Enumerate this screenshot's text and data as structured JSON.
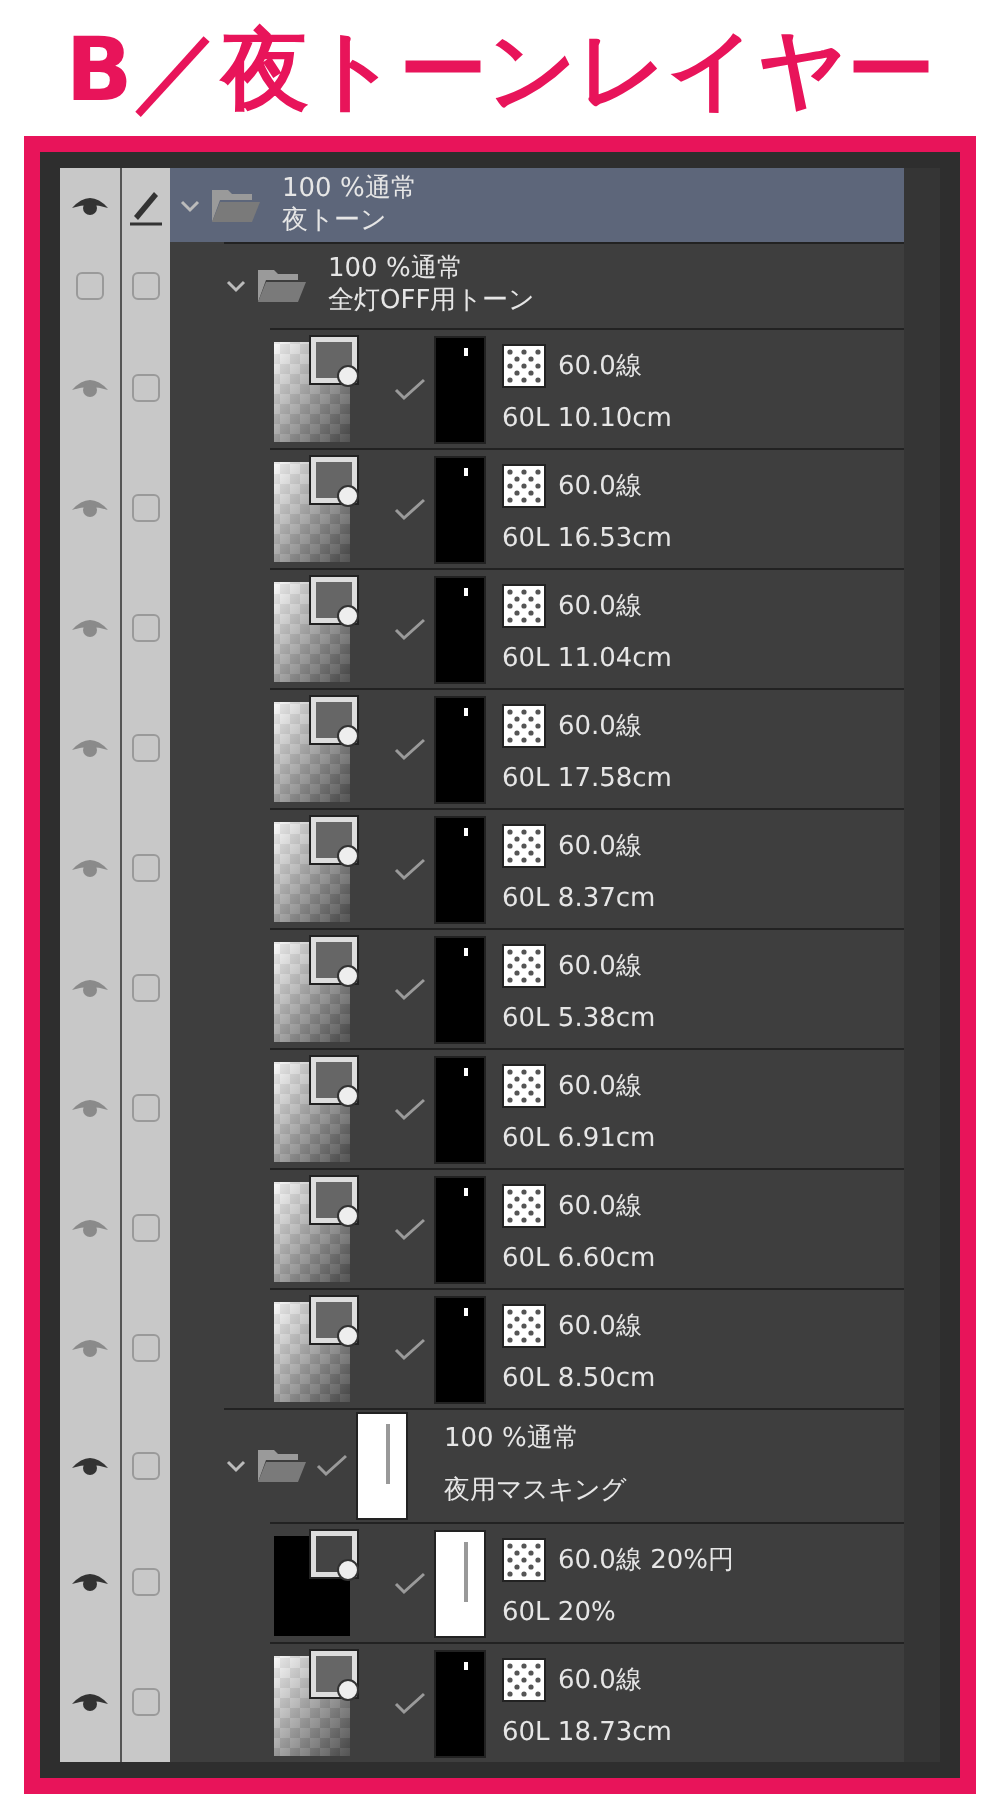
{
  "title": "B／夜トーンレイヤー",
  "layers": [
    {
      "kind": "folder",
      "selected": true,
      "visible": true,
      "editing": true,
      "expanded": true,
      "blend": "100 %通常",
      "name": "夜トーン",
      "children": [
        {
          "kind": "folder",
          "selected": false,
          "visible": false,
          "editing": false,
          "expanded": true,
          "blend": "100 %通常",
          "name": "全灯OFF用トーン",
          "children": [
            {
              "kind": "tone",
              "selected": false,
              "visible": true,
              "editing": false,
              "screen": "60.0線",
              "info": "60L 10.10cm",
              "base_black": false,
              "mask_white": false
            },
            {
              "kind": "tone",
              "selected": false,
              "visible": true,
              "editing": false,
              "screen": "60.0線",
              "info": "60L 16.53cm",
              "base_black": false,
              "mask_white": false
            },
            {
              "kind": "tone",
              "selected": false,
              "visible": true,
              "editing": false,
              "screen": "60.0線",
              "info": "60L 11.04cm",
              "base_black": false,
              "mask_white": false
            },
            {
              "kind": "tone",
              "selected": false,
              "visible": true,
              "editing": false,
              "screen": "60.0線",
              "info": "60L 17.58cm",
              "base_black": false,
              "mask_white": false
            },
            {
              "kind": "tone",
              "selected": false,
              "visible": true,
              "editing": false,
              "screen": "60.0線",
              "info": "60L 8.37cm",
              "base_black": false,
              "mask_white": false
            },
            {
              "kind": "tone",
              "selected": false,
              "visible": true,
              "editing": false,
              "screen": "60.0線",
              "info": "60L 5.38cm",
              "base_black": false,
              "mask_white": false
            },
            {
              "kind": "tone",
              "selected": false,
              "visible": true,
              "editing": false,
              "screen": "60.0線",
              "info": "60L 6.91cm",
              "base_black": false,
              "mask_white": false
            },
            {
              "kind": "tone",
              "selected": false,
              "visible": true,
              "editing": false,
              "screen": "60.0線",
              "info": "60L 6.60cm",
              "base_black": false,
              "mask_white": false
            },
            {
              "kind": "tone",
              "selected": false,
              "visible": true,
              "editing": false,
              "screen": "60.0線",
              "info": "60L 8.50cm",
              "base_black": false,
              "mask_white": false
            }
          ]
        },
        {
          "kind": "mask-folder",
          "selected": false,
          "visible": true,
          "editing": false,
          "expanded": true,
          "blend": "100 %通常",
          "name": "夜用マスキング",
          "children": [
            {
              "kind": "tone",
              "selected": false,
              "visible": true,
              "editing": false,
              "screen": "60.0線 20%円",
              "info": "60L 20%",
              "base_black": true,
              "mask_white": true
            },
            {
              "kind": "tone",
              "selected": false,
              "visible": true,
              "editing": false,
              "screen": "60.0線",
              "info": "60L 18.73cm",
              "base_black": false,
              "mask_white": false
            }
          ]
        }
      ]
    }
  ]
}
